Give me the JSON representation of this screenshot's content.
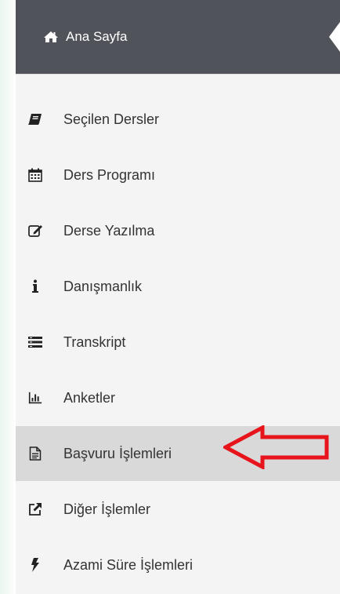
{
  "home": {
    "label": "Ana Sayfa",
    "icon": "home-icon"
  },
  "menu": [
    {
      "label": "Seçilen Dersler",
      "icon": "book-icon",
      "active": false
    },
    {
      "label": "Ders Programı",
      "icon": "calendar-icon",
      "active": false
    },
    {
      "label": "Derse Yazılma",
      "icon": "edit-icon",
      "active": false
    },
    {
      "label": "Danışmanlık",
      "icon": "info-icon",
      "active": false
    },
    {
      "label": "Transkript",
      "icon": "list-icon",
      "active": false
    },
    {
      "label": "Anketler",
      "icon": "bar-chart-icon",
      "active": false
    },
    {
      "label": "Başvuru İşlemleri",
      "icon": "document-icon",
      "active": true
    },
    {
      "label": "Diğer İşlemler",
      "icon": "external-link-icon",
      "active": false
    },
    {
      "label": "Azami Süre İşlemleri",
      "icon": "bolt-icon",
      "active": false
    }
  ],
  "annotation": {
    "icon": "red-arrow-icon",
    "color": "#e8141b"
  },
  "colors": {
    "header_bg": "#505359",
    "sidebar_bg": "#f4f4f4",
    "active_bg": "#d9d9d9"
  }
}
